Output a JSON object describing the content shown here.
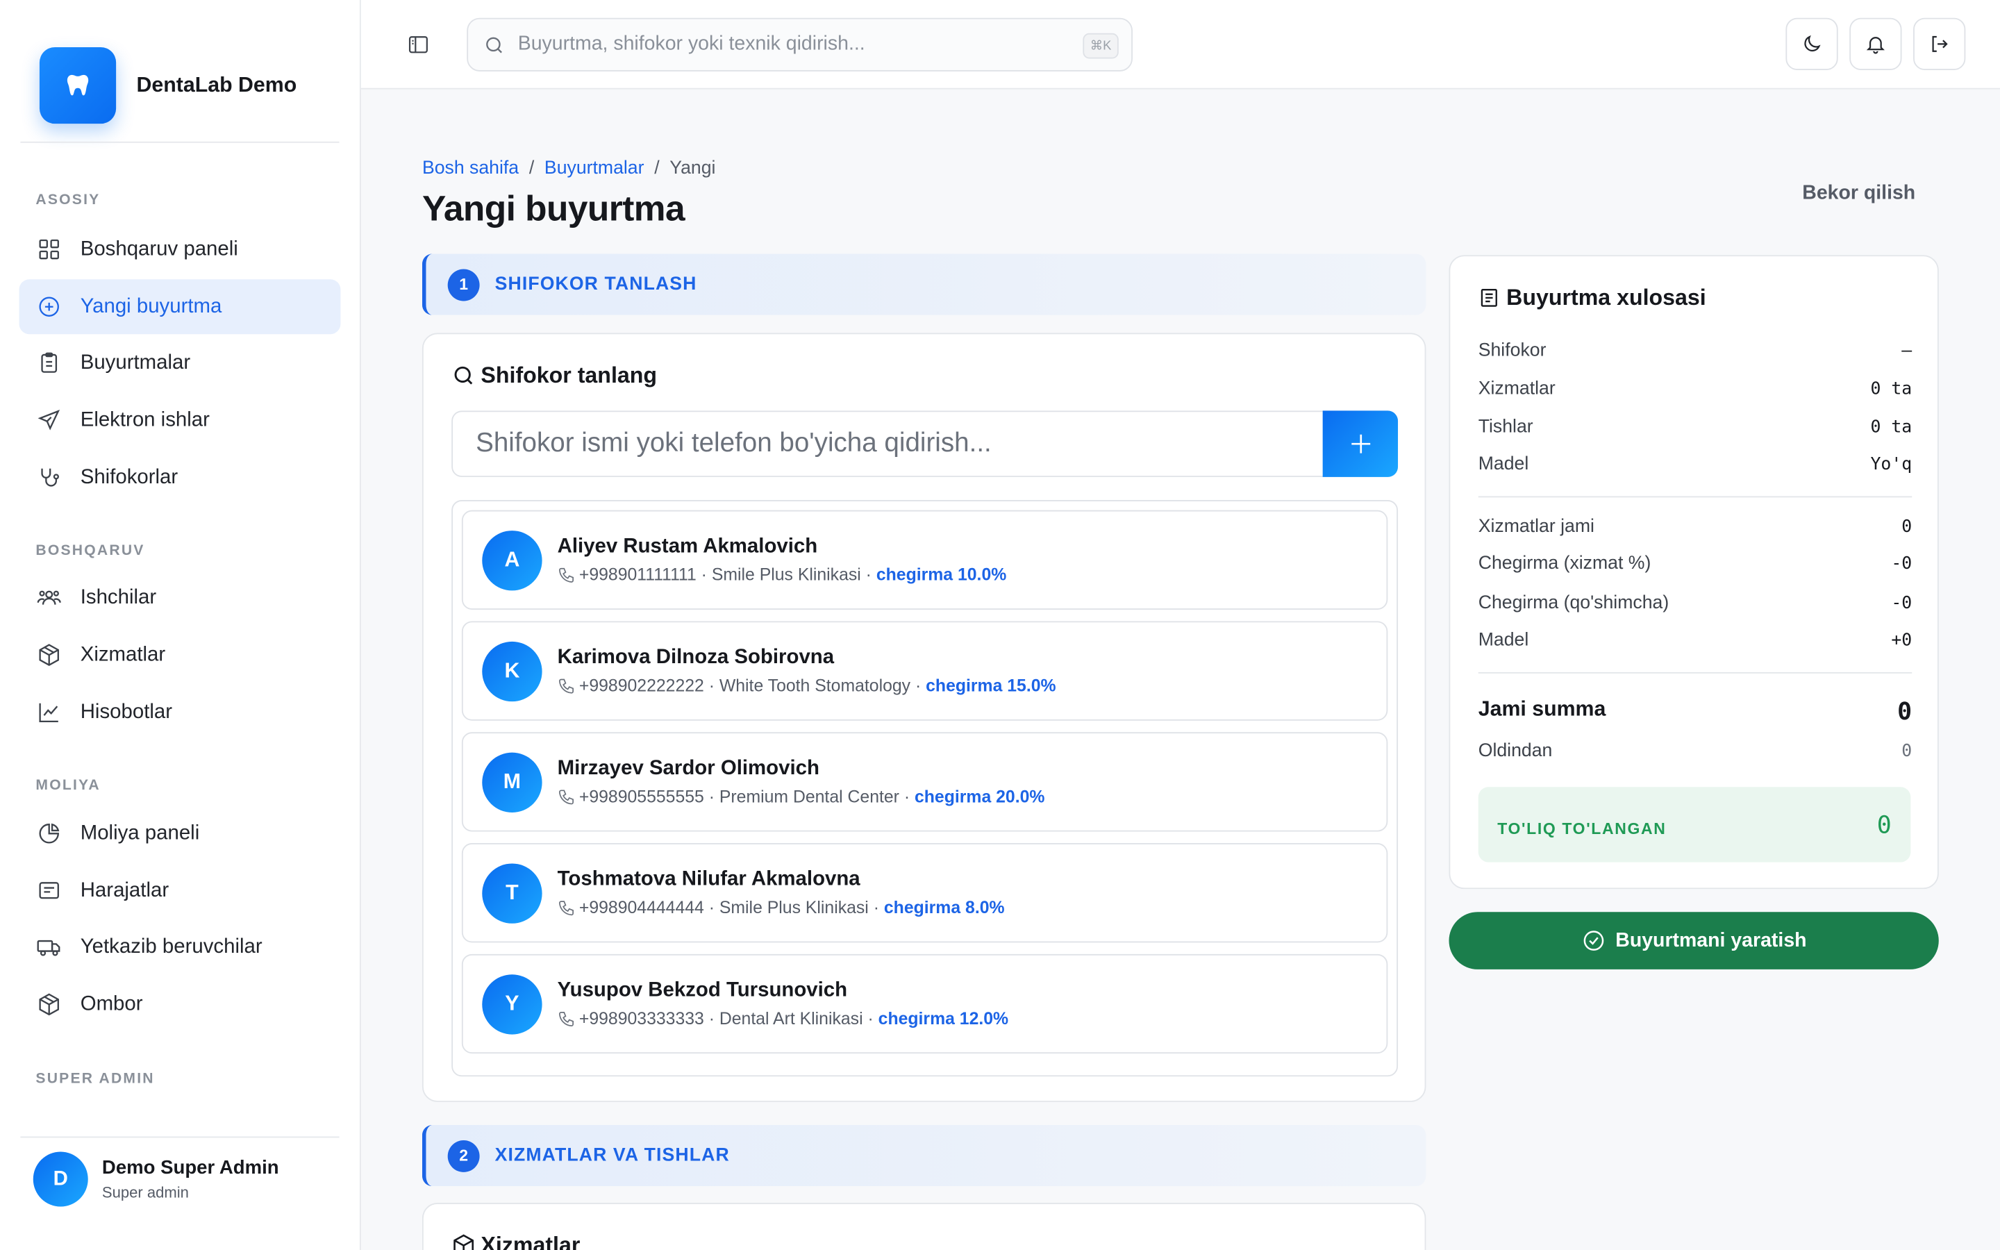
{
  "brand": {
    "name": "DentaLab Demo"
  },
  "sidebar": {
    "sections": [
      {
        "label": "ASOSIY"
      },
      {
        "label": "BOSHQARUV"
      },
      {
        "label": "MOLIYA"
      },
      {
        "label": "SUPER ADMIN"
      }
    ],
    "items": [
      {
        "label": "Boshqaruv paneli",
        "icon": "dashboard-icon"
      },
      {
        "label": "Yangi buyurtma",
        "icon": "plus-circle-icon",
        "active": true
      },
      {
        "label": "Buyurtmalar",
        "icon": "clipboard-icon"
      },
      {
        "label": "Elektron ishlar",
        "icon": "send-icon"
      },
      {
        "label": "Shifokorlar",
        "icon": "stethoscope-icon"
      },
      {
        "label": "Ishchilar",
        "icon": "users-icon"
      },
      {
        "label": "Xizmatlar",
        "icon": "box-icon"
      },
      {
        "label": "Hisobotlar",
        "icon": "chart-icon"
      },
      {
        "label": "Moliya paneli",
        "icon": "pie-icon"
      },
      {
        "label": "Harajatlar",
        "icon": "receipt-icon"
      },
      {
        "label": "Yetkazib beruvchilar",
        "icon": "truck-icon"
      },
      {
        "label": "Ombor",
        "icon": "box-icon"
      }
    ],
    "user": {
      "initial": "D",
      "name": "Demo Super Admin",
      "role": "Super admin"
    }
  },
  "topbar": {
    "search_placeholder": "Buyurtma, shifokor yoki texnik qidirish...",
    "shortcut": "⌘K"
  },
  "page": {
    "breadcrumb": [
      "Bosh sahifa",
      "Buyurtmalar",
      "Yangi"
    ],
    "title": "Yangi buyurtma",
    "cancel_label": "Bekor qilish"
  },
  "steps": [
    {
      "num": "1",
      "label": "SHIFOKOR TANLASH"
    },
    {
      "num": "2",
      "label": "XIZMATLAR VA TISHLAR"
    }
  ],
  "doctor_card": {
    "title": "Shifokor tanlang",
    "search_placeholder": "Shifokor ismi yoki telefon bo'yicha qidirish..."
  },
  "doctors": [
    {
      "initial": "A",
      "name": "Aliyev Rustam Akmalovich",
      "meta": "+998901111111 · Smile Plus Klinikasi · ",
      "discount": "chegirma 10.0%"
    },
    {
      "initial": "K",
      "name": "Karimova Dilnoza Sobirovna",
      "meta": "+998902222222 · White Tooth Stomatology · ",
      "discount": "chegirma 15.0%"
    },
    {
      "initial": "M",
      "name": "Mirzayev Sardor Olimovich",
      "meta": "+998905555555 · Premium Dental Center · ",
      "discount": "chegirma 20.0%"
    },
    {
      "initial": "T",
      "name": "Toshmatova Nilufar Akmalovna",
      "meta": "+998904444444 · Smile Plus Klinikasi · ",
      "discount": "chegirma 8.0%"
    },
    {
      "initial": "Y",
      "name": "Yusupov Bekzod Tursunovich",
      "meta": "+998903333333 · Dental Art Klinikasi · ",
      "discount": "chegirma 12.0%"
    }
  ],
  "services_card": {
    "title": "Xizmatlar"
  },
  "summary": {
    "title": "Buyurtma xulosasi",
    "rows1": [
      {
        "label": "Shifokor",
        "value": "—"
      },
      {
        "label": "Xizmatlar",
        "value": "0 ta"
      },
      {
        "label": "Tishlar",
        "value": "0 ta"
      },
      {
        "label": "Madel",
        "value": "Yo'q"
      }
    ],
    "rows2": [
      {
        "label": "Xizmatlar jami",
        "value": "0"
      },
      {
        "label": "Chegirma (xizmat %)",
        "value": "-0"
      },
      {
        "label": "Chegirma (qo'shimcha)",
        "value": "-0"
      },
      {
        "label": "Madel",
        "value": "+0"
      }
    ],
    "total_label": "Jami summa",
    "total_value": "0",
    "prepaid_label": "Oldindan",
    "prepaid_value": "0",
    "paid_label": "TO'LIQ TO'LANGAN",
    "paid_value": "0"
  },
  "create_button": "Buyurtmani yaratish",
  "colors": {
    "accent": "#1c64e6",
    "success": "#1b7e4c",
    "paid": "#1f9a55"
  }
}
